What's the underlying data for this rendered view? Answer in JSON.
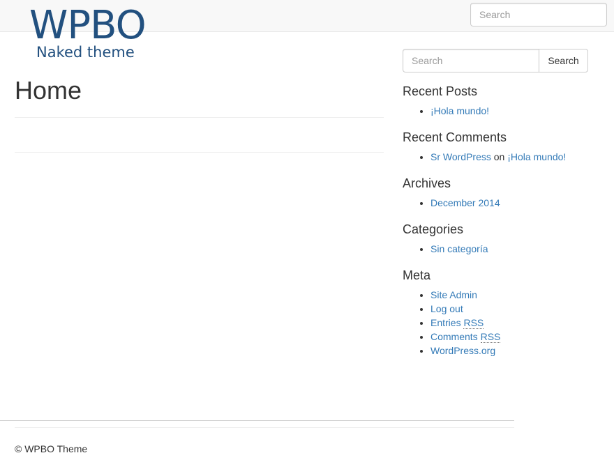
{
  "header": {
    "search_placeholder": "Search",
    "brand_title": "WPBO",
    "brand_subtitle": "Naked theme",
    "brand_color": "#22507f"
  },
  "main": {
    "title": "Home"
  },
  "sidebar": {
    "search_placeholder": "Search",
    "search_button": "Search",
    "recent_posts": {
      "title": "Recent Posts",
      "items": [
        "¡Hola mundo!"
      ]
    },
    "recent_comments": {
      "title": "Recent Comments",
      "author": "Sr WordPress",
      "on": "on",
      "post": "¡Hola mundo!"
    },
    "archives": {
      "title": "Archives",
      "items": [
        "December 2014"
      ]
    },
    "categories": {
      "title": "Categories",
      "items": [
        "Sin categoría"
      ]
    },
    "meta": {
      "title": "Meta",
      "site_admin": "Site Admin",
      "log_out": "Log out",
      "entries_prefix": "Entries ",
      "comments_prefix": "Comments ",
      "rss": "RSS",
      "wordpress_org": "WordPress.org"
    }
  },
  "footer": {
    "text": "© WPBO Theme"
  },
  "colors": {
    "link": "#337ab7",
    "navbar_bg": "#f8f8f8"
  }
}
